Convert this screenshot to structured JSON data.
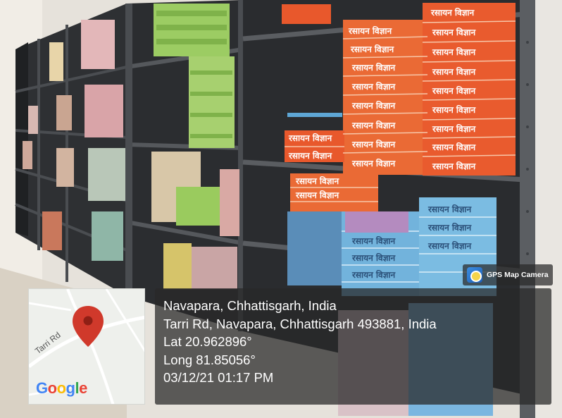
{
  "photo": {
    "shelf_book_titles": [
      "रसायन विज्ञान"
    ]
  },
  "overlay": {
    "badge_label": "GPS Map Camera",
    "badge_icon": "camera-pin-icon",
    "location_title": "Navapara, Chhattisgarh, India",
    "address": "Tarri Rd, Navapara, Chhattisgarh 493881, India",
    "latitude": "Lat 20.962896°",
    "longitude": "Long 81.85056°",
    "datetime": "03/12/21 01:17 PM"
  },
  "map": {
    "road_label": "Tarri Rd",
    "brand": "Google",
    "pin_icon": "map-pin-icon",
    "pin_color": "#d0392b"
  },
  "colors": {
    "shelf_metal": "#3a3c3f",
    "book_orange": "#e8582c",
    "book_blue": "#6fb1d8",
    "book_green": "#8fbf4c"
  }
}
